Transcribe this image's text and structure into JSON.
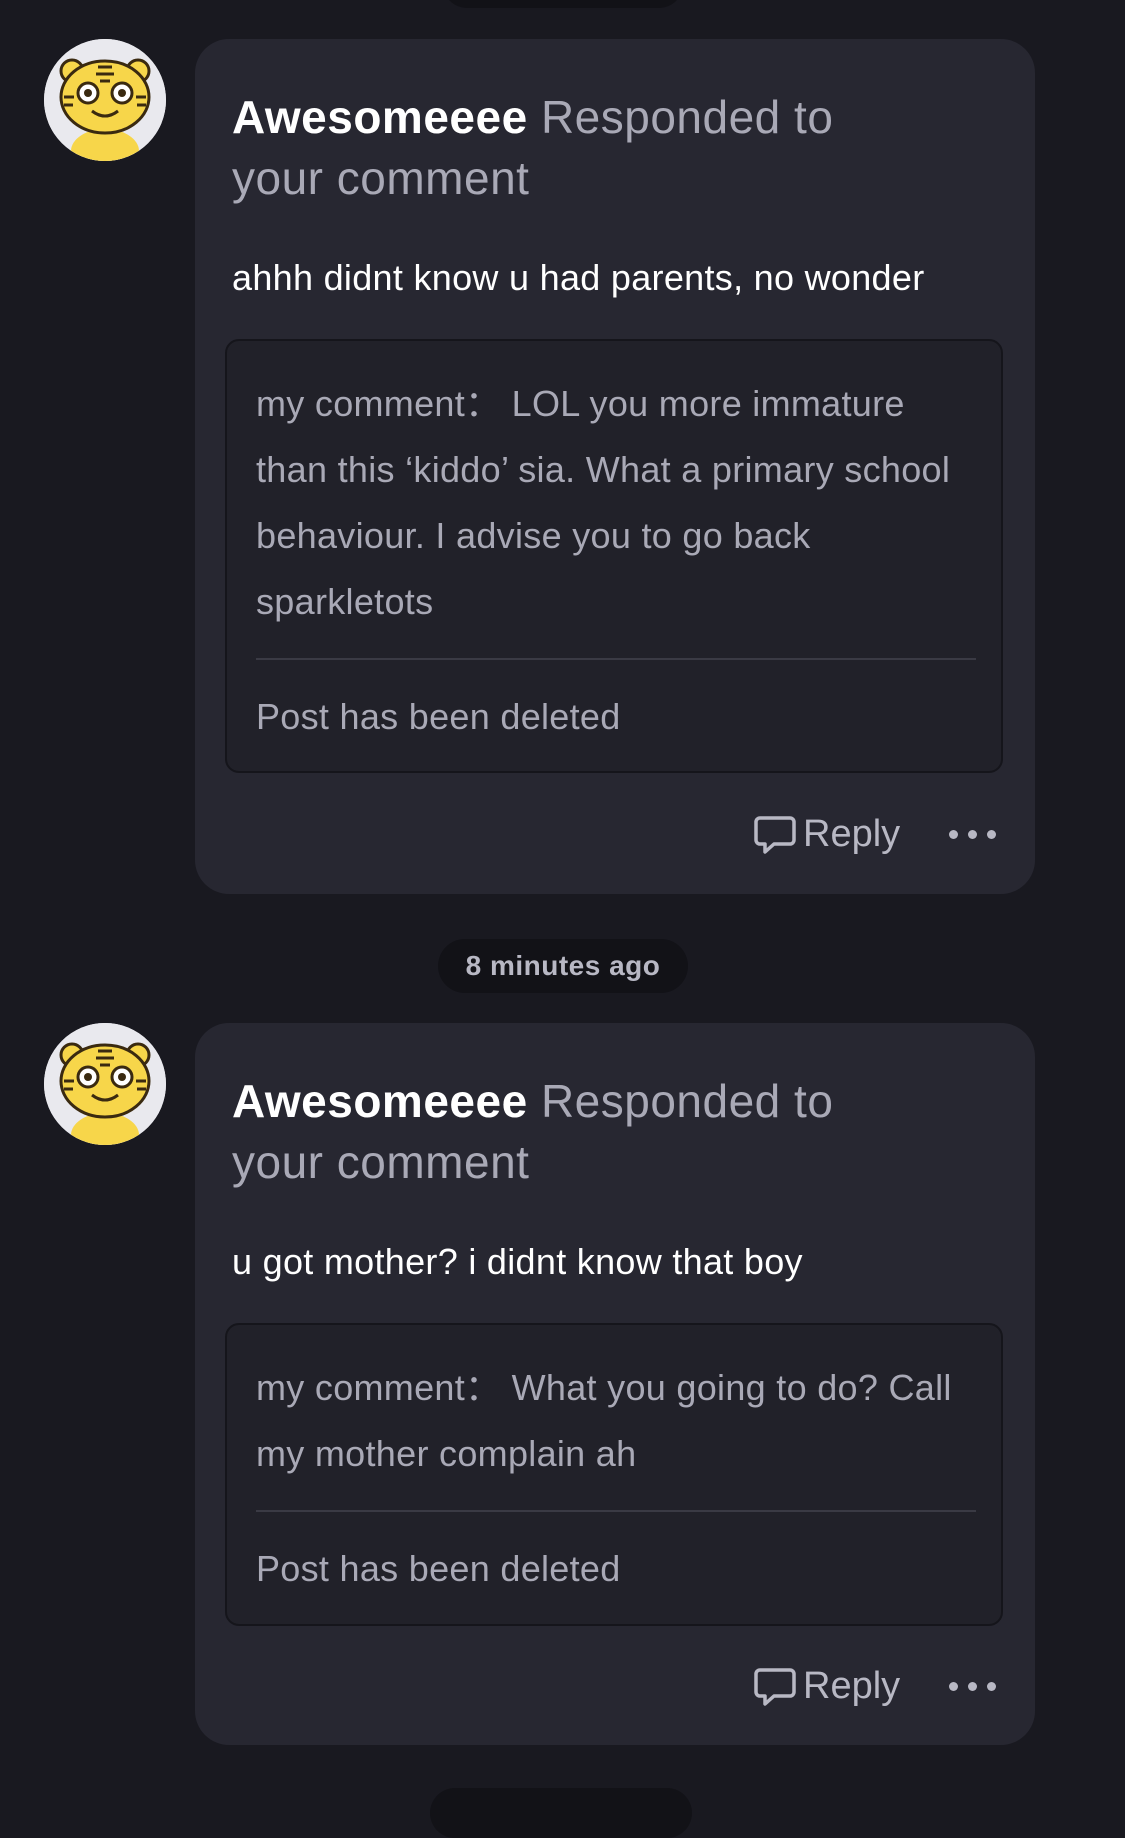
{
  "timestamps": {
    "between": "8 minutes ago"
  },
  "notifications": [
    {
      "username": "Awesomeeee",
      "action": "Responded to your comment",
      "reply_text": "ahhh didnt know u had parents, no wonder",
      "quoted_comment": "my comment： LOL you more immature than this ‘kiddo’ sia. What a primary school behaviour. I advise you to go back sparkletots",
      "post_status": "Post has been deleted",
      "reply_label": "Reply",
      "avatar_icon": "tiger-avatar-icon",
      "more_icon": "more-dots-icon"
    },
    {
      "username": "Awesomeeee",
      "action": "Responded to your comment",
      "reply_text": "u got mother? i didnt know that boy",
      "quoted_comment": "my comment： What you going to do? Call my mother complain ah",
      "post_status": "Post has been deleted",
      "reply_label": "Reply",
      "avatar_icon": "tiger-avatar-icon",
      "more_icon": "more-dots-icon"
    }
  ],
  "colors": {
    "background": "#191920",
    "card": "#272731",
    "quote_box": "#212129",
    "muted_text": "#a9a9b6",
    "avatar_yellow": "#f7d64a"
  }
}
